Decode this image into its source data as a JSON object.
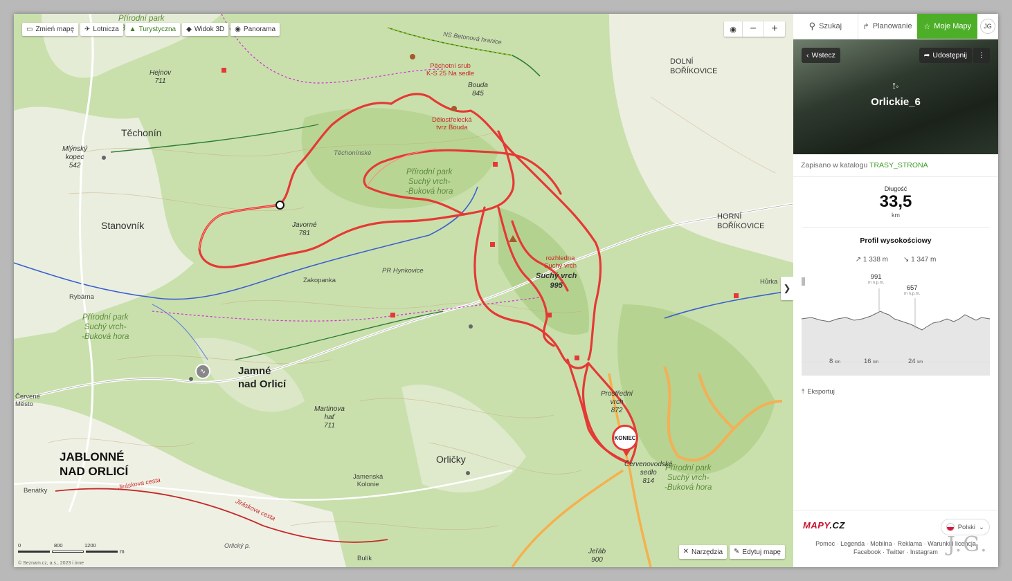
{
  "map": {
    "toolbar": {
      "change_map": "Zmień mapę",
      "aerial": "Lotnicza",
      "tourist": "Turystyczna",
      "view3d": "Widok 3D",
      "panorama": "Panorama"
    },
    "zoom": {
      "locate_icon": "target-icon",
      "minus": "−",
      "plus": "+"
    },
    "expand": "❯",
    "labels": {
      "techonin": "Těchonín",
      "stanovnik": "Stanovník",
      "jamne": "Jamné\nnad Orlicí",
      "jablonne": "JABLONNÉ\nNAD ORLICÍ",
      "orlicky": "Orličky",
      "dolni": "DOLNÍ\nBOŘÍKOVICE",
      "horni": "HORNÍ\nBOŘÍKOVICE",
      "park1": "Přírodní park\nSuchý vrch-\n-Buková hora",
      "park2": "Přírodní park\nSuchý vrch-\n-Buková hora",
      "park3": "Přírodní park\nSuchý vrch-\n-Buková hora",
      "park4": "Přírodní park\n-Buková hora",
      "hejnov": "Hejnov\n711",
      "mlynsky": "Mlýnský\nkopec\n542",
      "javorne": "Javorné\n781",
      "martinova": "Martinova\nhať\n711",
      "prostredni": "Prostřední\nvrch\n872",
      "cervenovodske": "Červenovodské\nsedlo\n814",
      "suchy": "Suchý vrch\n995",
      "pr_hynkovice": "PR Hynkovice",
      "zakopanka": "Zakopanka",
      "rybarna": "Rybárna",
      "cervene": "Červené\nMěsto",
      "jamenska": "Jamenská\nKolonie",
      "benatky": "Benátky",
      "bouda": "Bouda\n845",
      "hurka": "Hůrka",
      "jerab": "Jeřáb\n900",
      "bulik": "Bulík",
      "techoninske": "Těchonínské",
      "pechotni": "Pěchotní srub\nK-S 25 Na sedle",
      "delostrelecka": "Dělostřelecká\ntvrz Bouda",
      "rozhledna": "rozhledna\nSuchý vrch",
      "ns_betonova": "NS Betonová hranice",
      "jiraskova1": "Jiráskova cesta",
      "jiraskova2": "Jiráskova cesta",
      "orlicky_p": "Orlický p.",
      "konec": "KONIEC"
    },
    "bottom_tools": {
      "tools": "Narzędzia",
      "edit": "Edytuj mapę"
    },
    "scale": {
      "t0": "0",
      "t1": "800",
      "t2": "1200",
      "unit": "m"
    },
    "copyright": "© Seznam.cz, a.s., 2023 i inne"
  },
  "sidebar": {
    "nav": {
      "search": "Szukaj",
      "plan": "Planowanie",
      "my": "Moje Mapy",
      "user": "JG"
    },
    "back": "Wstecz",
    "share": "Udostępnij",
    "more": "⋮",
    "route_title": "Orlickie_6",
    "catalog_prefix": "Zapisano w katalogu",
    "catalog_name": "TRASY_STRONA",
    "length_label": "Długość",
    "length_value": "33,5",
    "length_unit": "km",
    "profile_title": "Profil wysokościowy",
    "ascent": "1 338 m",
    "descent": "1 347 m",
    "profile": {
      "peak1_value": "991",
      "peak1_unit": "m n.p.m.",
      "peak2_value": "657",
      "peak2_unit": "m n.p.m.",
      "ticks": [
        "8",
        "16",
        "24"
      ],
      "tick_unit": "km"
    },
    "export": "Eksportuj",
    "language": "Polski",
    "footer_links_1": "Pomoc · Legenda · Mobilna · Reklama · Warunki i licencja",
    "footer_links_2": "Facebook · Twitter · Instagram"
  },
  "watermark": "J.G.",
  "colors": {
    "route": "#e53935",
    "accent": "#4caf27",
    "forest": "#b9d99a",
    "meadow": "#eef2e2"
  }
}
